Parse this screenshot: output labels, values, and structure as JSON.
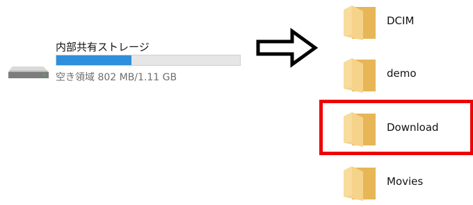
{
  "drive": {
    "icon": "hard-drive-icon",
    "name": "内部共有ストレージ",
    "space_text": "空き領域 802 MB/1.11 GB",
    "used_fraction": 0.41,
    "fill_color": "#2d8fdd"
  },
  "arrow": {
    "icon": "right-arrow-outline-icon"
  },
  "folders": [
    {
      "label": "DCIM",
      "icon": "folder-icon"
    },
    {
      "label": "demo",
      "icon": "folder-icon"
    },
    {
      "label": "Download",
      "icon": "folder-icon",
      "highlighted": true
    },
    {
      "label": "Movies",
      "icon": "folder-icon"
    }
  ],
  "colors": {
    "highlight": "#ee0000",
    "folder_front": "#f5d38a",
    "folder_back": "#e7b657"
  }
}
